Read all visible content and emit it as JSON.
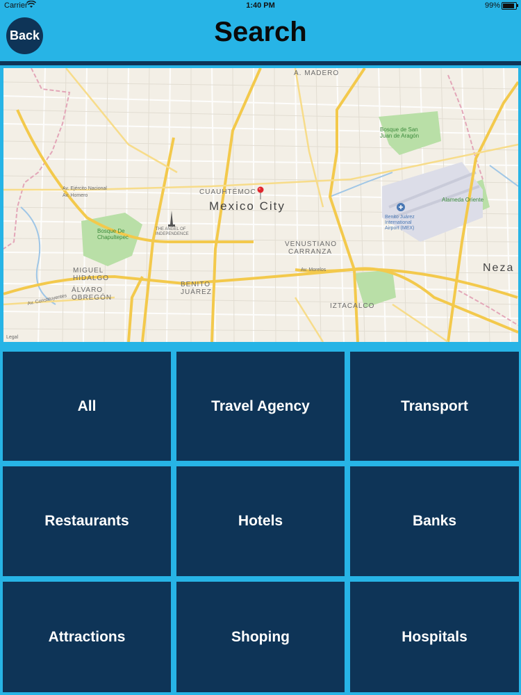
{
  "status_bar": {
    "carrier": "Carrier",
    "time": "1:40 PM",
    "battery_percent": "99%",
    "battery_level": 0.99
  },
  "header": {
    "back_label": "Back",
    "title": "Search"
  },
  "map": {
    "city_label": "Mexico City",
    "labels": {
      "madero": "A. MADERO",
      "cuauhtemoc": "CUAUHTÉMOC",
      "angel": "THE ANGEL OF",
      "angel2": "INDEPENDENCE",
      "bosque_chapultepec": "Bosque De",
      "bosque_chapultepec2": "Chapultepec",
      "miguel_hidalgo": "MIGUEL",
      "miguel_hidalgo2": "HIDALGO",
      "alvaro": "ÁLVARO",
      "alvaro2": "OBREGÓN",
      "benito": "BENITO",
      "benito2": "JUÁREZ",
      "venustiano": "VENUSTIANO",
      "venustiano2": "CARRANZA",
      "iztacalco": "IZTACALCO",
      "neza": "Neza",
      "airport": "Benito Juárez",
      "airport2": "International",
      "airport3": "Airport (MEX)",
      "alameda": "Alameda Oriente",
      "aragon": "Bosque de San",
      "aragon2": "Juan de Aragón",
      "ejercito": "Av. Ejército Nacional",
      "homero": "Av. Homero",
      "morelos": "Av. Morelos",
      "constituyentes": "Av. Constituyentes",
      "legal": "Legal"
    }
  },
  "categories": [
    {
      "label": "All"
    },
    {
      "label": "Travel Agency"
    },
    {
      "label": "Transport"
    },
    {
      "label": "Restaurants"
    },
    {
      "label": "Hotels"
    },
    {
      "label": "Banks"
    },
    {
      "label": "Attractions"
    },
    {
      "label": "Shoping"
    },
    {
      "label": "Hospitals"
    }
  ],
  "colors": {
    "background": "#27b4e6",
    "tile": "#0e3457",
    "back_button": "#0e3457"
  },
  "icons": [
    "wifi-icon",
    "battery-icon",
    "map-pin-icon",
    "airport-icon",
    "park-icon",
    "monument-icon"
  ]
}
